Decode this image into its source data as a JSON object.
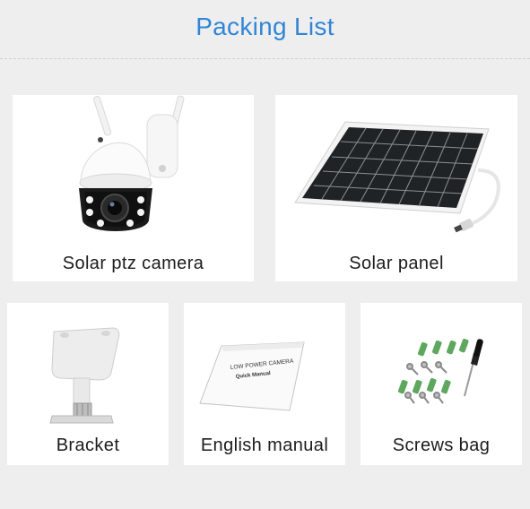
{
  "title": "Packing List",
  "items": [
    {
      "label": "Solar ptz camera",
      "icon": "ptz-camera-icon"
    },
    {
      "label": "Solar panel",
      "icon": "solar-panel-icon"
    },
    {
      "label": "Bracket",
      "icon": "bracket-icon"
    },
    {
      "label": "English manual",
      "icon": "manual-icon",
      "cover_lines": [
        "LOW POWER CAMERA",
        "Quick Manual"
      ]
    },
    {
      "label": "Screws bag",
      "icon": "screws-icon"
    }
  ],
  "colors": {
    "title": "#2f86d6",
    "background": "#efeeef",
    "card": "#ffffff"
  }
}
